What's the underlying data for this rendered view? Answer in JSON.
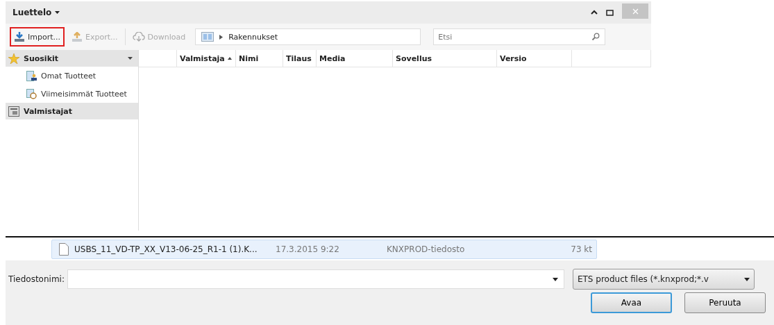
{
  "window": {
    "title": "Luettelo",
    "title_menu": true
  },
  "toolbar": {
    "buttons": [
      {
        "label": "Import...",
        "kind": "import",
        "disabled": false,
        "highlighted": true
      },
      {
        "label": "Export...",
        "kind": "export",
        "disabled": true,
        "highlighted": false
      },
      {
        "label": "Download",
        "kind": "download",
        "disabled": true,
        "highlighted": false
      }
    ],
    "breadcrumb": [
      "Rakennukset"
    ],
    "search": {
      "placeholder": "Etsi"
    }
  },
  "sidebar": {
    "items": [
      {
        "label": "Suosikit",
        "kind": "favorites",
        "expanded": true,
        "children": [
          {
            "label": "Omat Tuotteet",
            "kind": "own"
          },
          {
            "label": "Viimeisimmät Tuotteet",
            "kind": "recent"
          }
        ]
      },
      {
        "label": "Valmistajat",
        "kind": "manufacturers",
        "expanded": false
      }
    ]
  },
  "table": {
    "columns": [
      {
        "label": "Valmistaja",
        "sorted": true
      },
      {
        "label": "Nimi",
        "sorted": false
      },
      {
        "label": "Tilaus",
        "sorted": false
      },
      {
        "label": "Media",
        "sorted": false
      },
      {
        "label": "Sovellus",
        "sorted": false
      },
      {
        "label": "Versio",
        "sorted": false
      }
    ]
  },
  "file_list": {
    "rows": [
      {
        "name": "USBS_11_VD-TP_XX_V13-06-25_R1-1 (1).K...",
        "date": "17.3.2015 9:22",
        "type": "KNXPROD-tiedosto",
        "size": "73 kt",
        "selected": true
      }
    ]
  },
  "file_dialog": {
    "filename_label": "Tiedostonimi:",
    "filter": "ETS product files (*.knxprod;*.v",
    "buttons": [
      {
        "label": "Avaa",
        "default": true
      },
      {
        "label": "Peruuta",
        "default": false
      }
    ]
  }
}
